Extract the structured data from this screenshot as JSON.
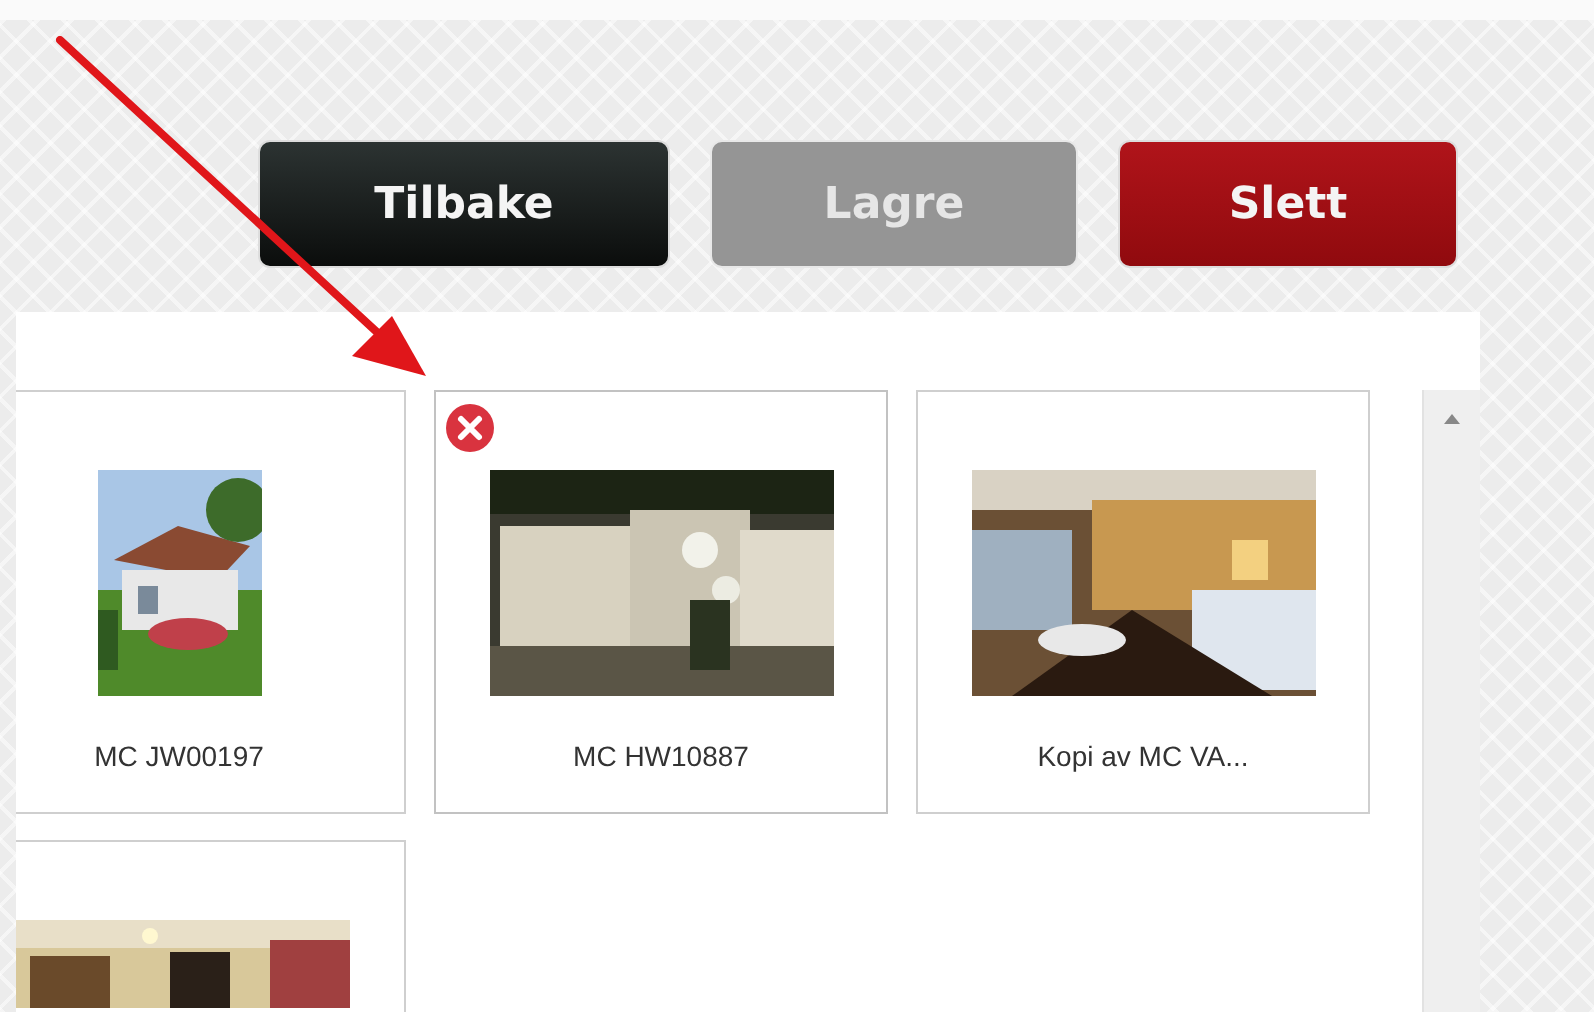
{
  "toolbar": {
    "buttons": [
      {
        "label": "Tilbake",
        "kind": "dark",
        "disabled": false
      },
      {
        "label": "Lagre",
        "kind": "neutral",
        "disabled": true
      },
      {
        "label": "Slett",
        "kind": "danger",
        "disabled": false
      }
    ]
  },
  "gallery": {
    "items": [
      {
        "name": "MC JW00197",
        "delete_visible": false
      },
      {
        "name": "MC HW10887",
        "delete_visible": true
      },
      {
        "name": "Kopi av MC VA...",
        "delete_visible": false
      },
      {
        "delete_visible": false
      }
    ]
  }
}
